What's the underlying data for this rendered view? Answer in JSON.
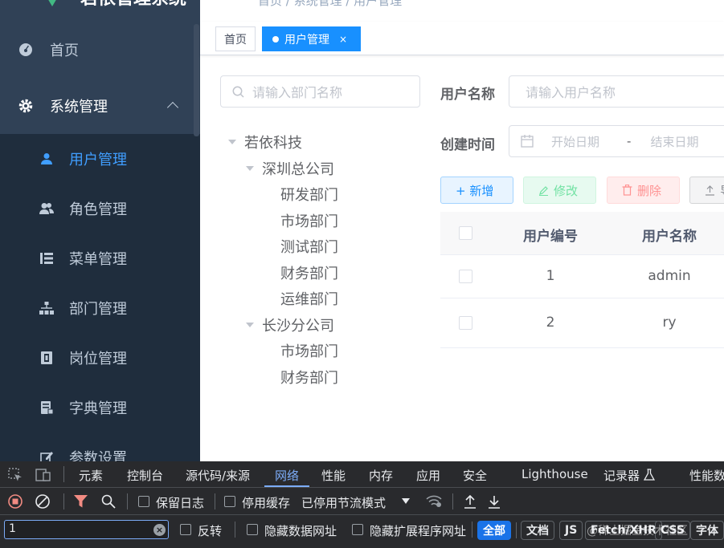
{
  "app": {
    "logo_text": "若依管理系统"
  },
  "sidebar": {
    "items": [
      {
        "label": "首页",
        "icon": "dashboard-icon"
      },
      {
        "label": "系统管理",
        "icon": "gear-icon"
      }
    ],
    "submenu": [
      {
        "label": "用户管理",
        "icon": "user-icon",
        "active": true
      },
      {
        "label": "角色管理",
        "icon": "peoples-icon"
      },
      {
        "label": "菜单管理",
        "icon": "tree-table-icon"
      },
      {
        "label": "部门管理",
        "icon": "org-tree-icon"
      },
      {
        "label": "岗位管理",
        "icon": "post-icon"
      },
      {
        "label": "字典管理",
        "icon": "dict-icon"
      },
      {
        "label": "参数设置",
        "icon": "edit-icon"
      }
    ]
  },
  "navbar": {
    "breadcrumb": "首页 / 系统管理 / 用户管理"
  },
  "tags": [
    {
      "label": "首页"
    },
    {
      "label": "用户管理",
      "close": "×"
    }
  ],
  "dept": {
    "search_placeholder": "请输入部门名称",
    "tree": [
      {
        "label": "若依科技"
      },
      {
        "label": "深圳总公司"
      },
      {
        "label": "研发部门"
      },
      {
        "label": "市场部门"
      },
      {
        "label": "测试部门"
      },
      {
        "label": "财务部门"
      },
      {
        "label": "运维部门"
      },
      {
        "label": "长沙分公司"
      },
      {
        "label": "市场部门"
      },
      {
        "label": "财务部门"
      }
    ]
  },
  "form": {
    "username_label": "用户名称",
    "username_placeholder": "请输入用户名称",
    "date_label": "创建时间",
    "start_placeholder": "开始日期",
    "date_sep": "-",
    "end_placeholder": "结束日期"
  },
  "toolbar": {
    "add": "+ 新增",
    "edit": "修改",
    "delete": "删除",
    "import": "导入"
  },
  "table": {
    "headers": [
      "用户编号",
      "用户名称"
    ],
    "rows": [
      {
        "id": "1",
        "name": "admin"
      },
      {
        "id": "2",
        "name": "ry"
      }
    ]
  },
  "devtools": {
    "tabs": [
      "元素",
      "控制台",
      "源代码/来源",
      "网络",
      "性能",
      "内存",
      "应用",
      "安全",
      "Lighthouse",
      "记录器",
      "性能数"
    ],
    "active_tab": "网络",
    "preserve_log": "保留日志",
    "disable_cache": "停用缓存",
    "throttling": "已停用节流模式",
    "filter_value": "1",
    "invert": "反转",
    "hide_data_urls": "隐藏数据网址",
    "hide_ext_urls": "隐藏扩展程序网址",
    "type_filters": [
      "全部",
      "文档",
      "JS",
      "Fetch/XHR",
      "CSS",
      "字体"
    ]
  },
  "watermark": "@稀土掘金技术社区",
  "colors": {
    "sidebar_bg": "#304156",
    "submenu_bg": "#1f2d3d",
    "primary": "#1890ff",
    "success": "#13ce66",
    "danger": "#ff4949",
    "devtools_bg": "#292a2d"
  }
}
